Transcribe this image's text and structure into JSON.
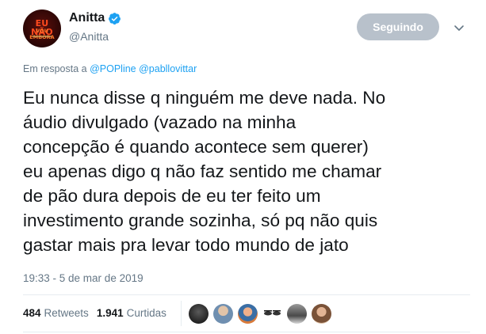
{
  "author": {
    "display_name": "Anitta",
    "handle": "@Anitta",
    "avatar_icon": "profile-avatar",
    "avatar_text_1": "EU NÃO",
    "avatar_text_2": "VOU EMBORA",
    "verified_icon": "verified-badge-icon",
    "verified_color": "#1da1f2"
  },
  "follow_button": {
    "label": "Seguindo",
    "color": "#b8c1cb"
  },
  "menu_icon": "chevron-down-icon",
  "reply_context": {
    "prefix": "Em resposta a",
    "mention_1": "@POPline",
    "mention_2": "@pabllovittar"
  },
  "tweet": {
    "lines": [
      "Eu nunca disse q ninguém me deve nada. No",
      "áudio divulgado (vazado na minha",
      "concepção é quando acontece sem querer)",
      "eu apenas digo q não faz sentido me chamar",
      "de pão dura depois de eu ter feito um",
      "investimento grande sozinha, só pq não quis",
      "gastar mais pra levar todo mundo de jato"
    ],
    "timestamp": "19:33 - 5 de mar de 2019"
  },
  "stats": {
    "retweets_count": "484",
    "retweets_label": "Retweets",
    "likes_count": "1.941",
    "likes_label": "Curtidas"
  },
  "likers": [
    {
      "icon": "liker-avatar",
      "color": "#2b2b2b"
    },
    {
      "icon": "liker-avatar",
      "color": "#8fa3b8"
    },
    {
      "icon": "liker-avatar",
      "color": "#c9865a"
    },
    {
      "icon": "liker-avatar",
      "color": "#ffffff"
    },
    {
      "icon": "liker-avatar",
      "color": "#6d6d6d"
    },
    {
      "icon": "liker-avatar",
      "color": "#b58a6a"
    }
  ]
}
